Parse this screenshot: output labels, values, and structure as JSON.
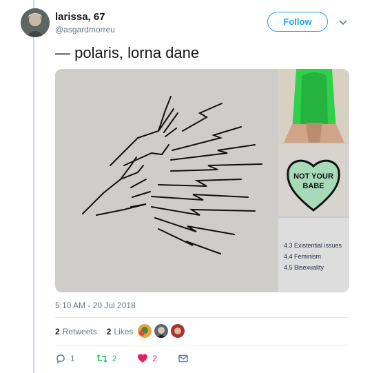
{
  "user": {
    "name": "larissa, 67",
    "handle": "@asgardmorreu"
  },
  "follow_button": "Follow",
  "tweet": {
    "text": "— polaris, lorna dane",
    "timestamp": "5:10 AM - 20 Jul 2018"
  },
  "media": {
    "heart_text_line1": "NOT YOUR",
    "heart_text_line2": "BABE",
    "toc": [
      "4.3  Existential issues",
      "4.4  Feminism",
      "4.5  Bisexuality"
    ]
  },
  "stats": {
    "retweets_count": "2",
    "retweets_label": "Retweets",
    "likes_count": "2",
    "likes_label": "Likes"
  },
  "actions": {
    "reply_count": "1",
    "retweet_count": "2",
    "like_count": "2"
  },
  "colors": {
    "accent": "#1da1f2",
    "retweet": "#17bf63",
    "like": "#e0245e",
    "hair_green": "#2fd04a",
    "heart_mint": "#a8d9b8"
  },
  "icons": {
    "chevron": "chevron-down-icon",
    "reply": "reply-icon",
    "retweet": "retweet-icon",
    "like": "heart-icon",
    "dm": "envelope-icon"
  }
}
